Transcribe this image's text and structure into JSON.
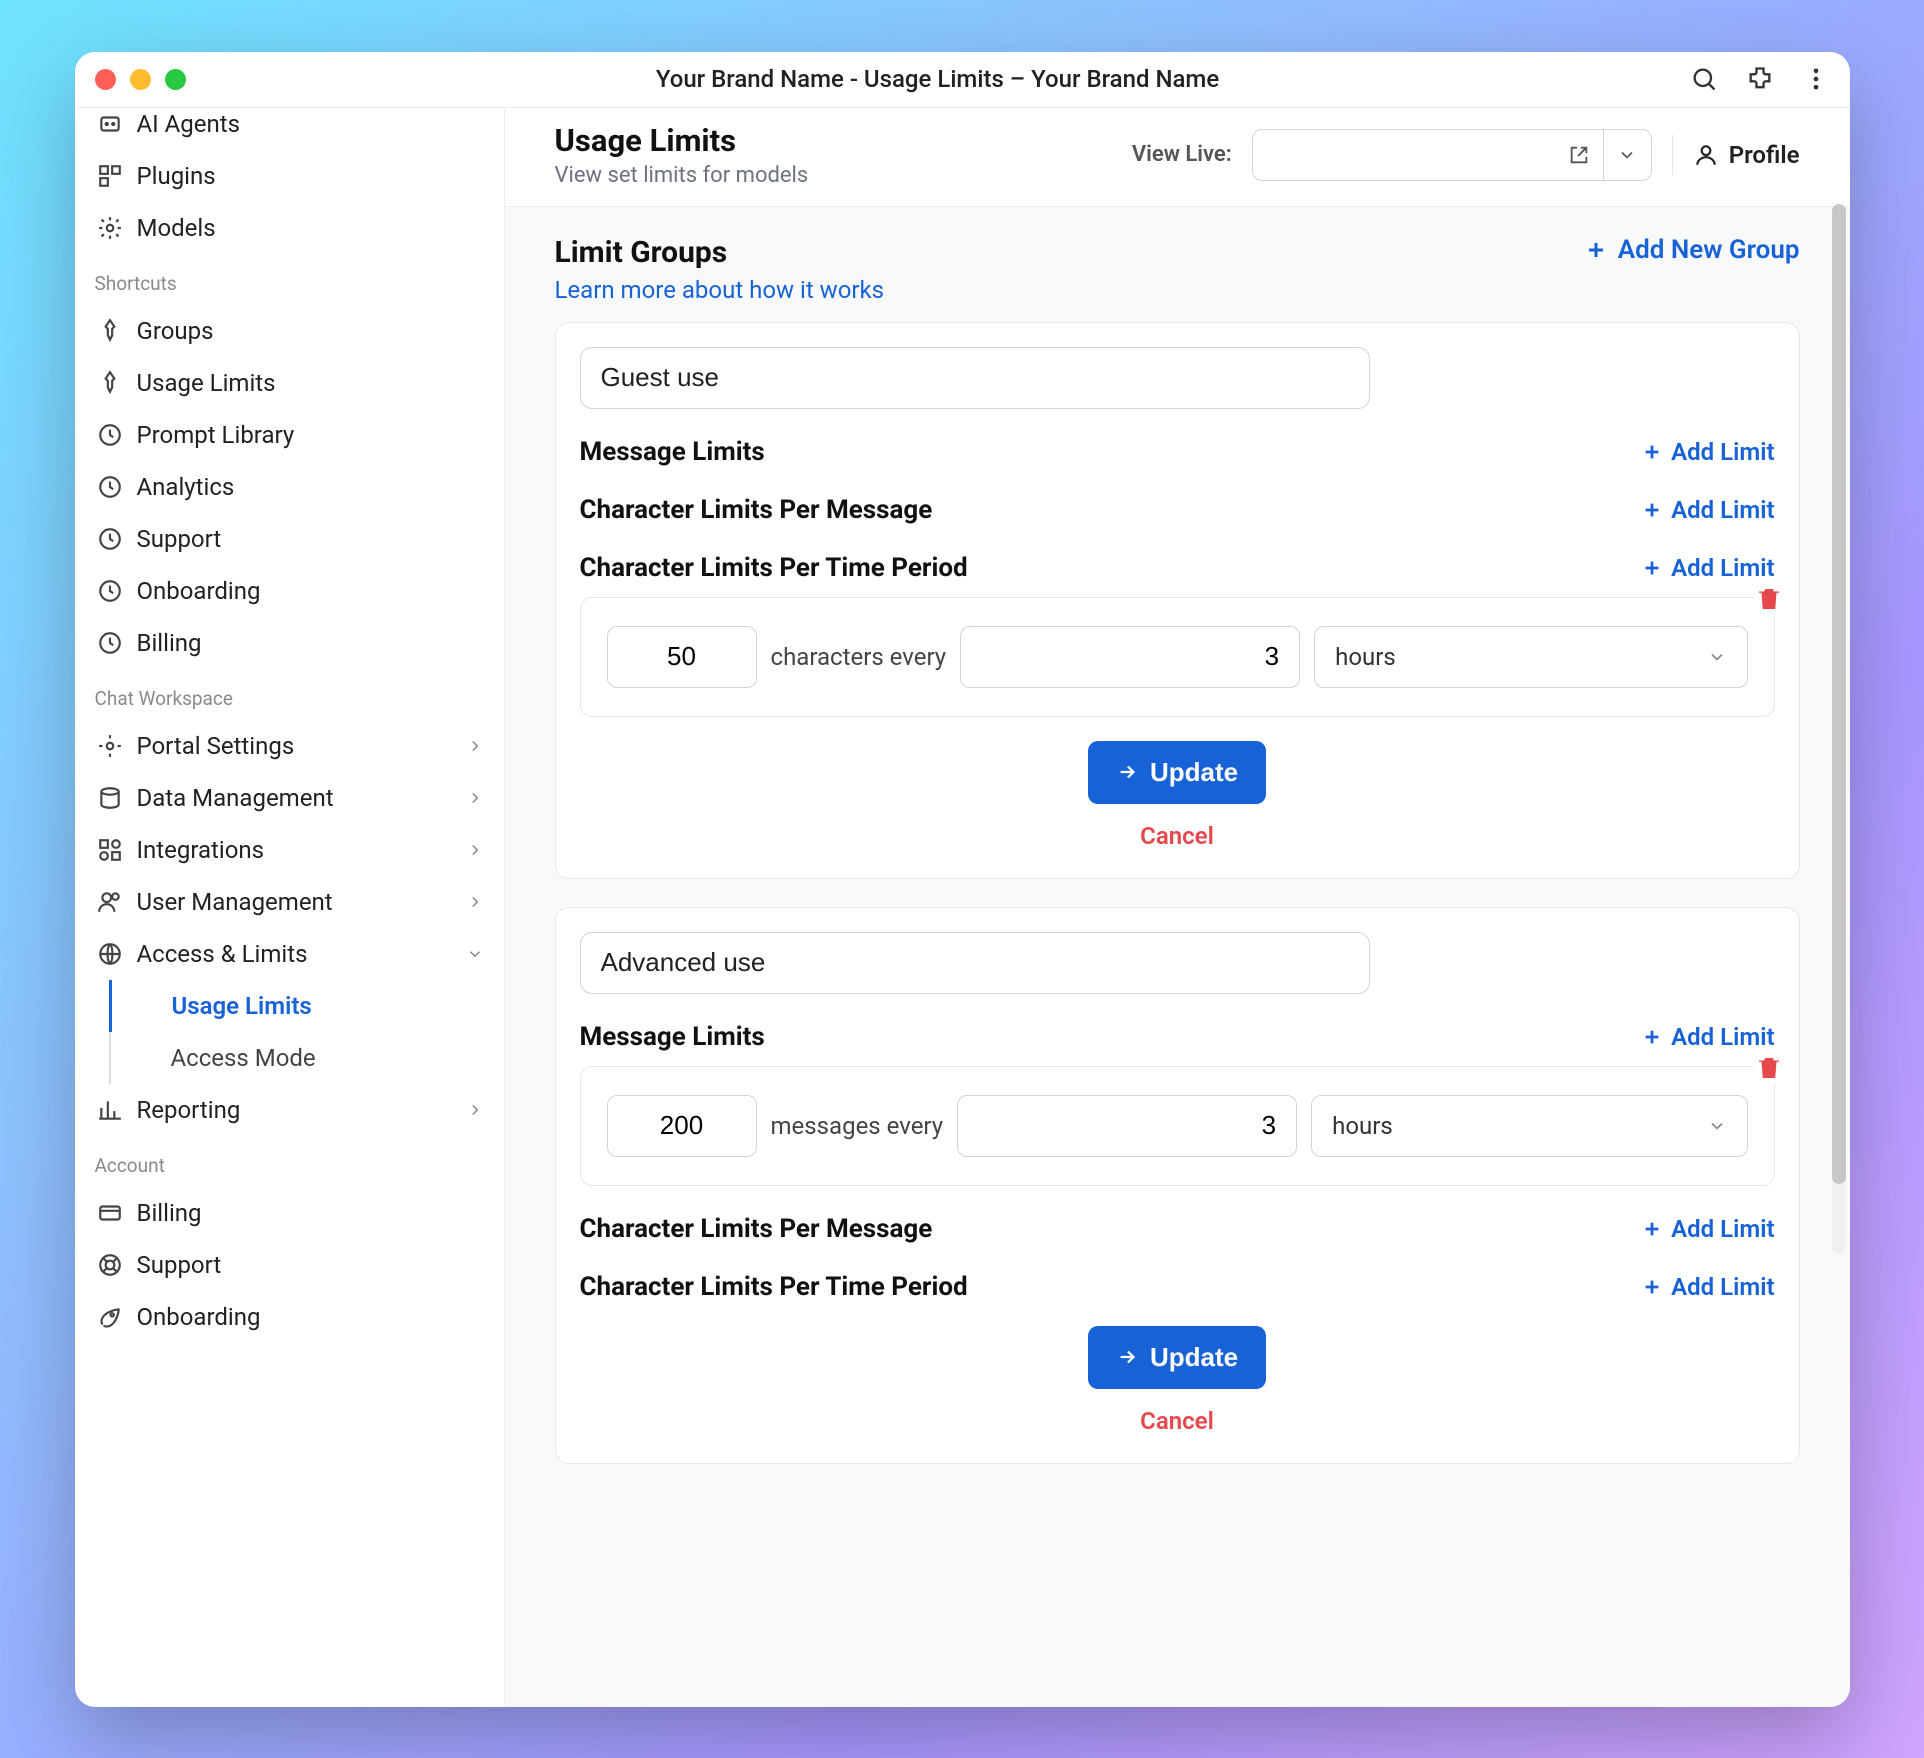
{
  "window_title": "Your Brand Name - Usage Limits – Your Brand Name",
  "sidebar": {
    "top_items": [
      {
        "icon": "ai-agents",
        "label": "AI Agents"
      },
      {
        "icon": "plugins",
        "label": "Plugins"
      },
      {
        "icon": "models",
        "label": "Models"
      }
    ],
    "shortcuts_label": "Shortcuts",
    "shortcuts": [
      {
        "icon": "pin",
        "label": "Groups"
      },
      {
        "icon": "pin",
        "label": "Usage Limits"
      },
      {
        "icon": "clock",
        "label": "Prompt Library"
      },
      {
        "icon": "clock",
        "label": "Analytics"
      },
      {
        "icon": "clock",
        "label": "Support"
      },
      {
        "icon": "clock",
        "label": "Onboarding"
      },
      {
        "icon": "clock",
        "label": "Billing"
      }
    ],
    "workspace_label": "Chat Workspace",
    "workspace": [
      {
        "icon": "gear",
        "label": "Portal Settings",
        "chev": true
      },
      {
        "icon": "db",
        "label": "Data Management",
        "chev": true
      },
      {
        "icon": "grid",
        "label": "Integrations",
        "chev": true
      },
      {
        "icon": "users",
        "label": "User Management",
        "chev": true
      },
      {
        "icon": "globe",
        "label": "Access & Limits",
        "chev": true,
        "open": true,
        "subs": [
          {
            "label": "Usage Limits",
            "active": true
          },
          {
            "label": "Access Mode",
            "active": false
          }
        ]
      },
      {
        "icon": "chart",
        "label": "Reporting",
        "chev": true
      }
    ],
    "account_label": "Account",
    "account": [
      {
        "icon": "card",
        "label": "Billing"
      },
      {
        "icon": "support",
        "label": "Support"
      },
      {
        "icon": "rocket",
        "label": "Onboarding"
      }
    ]
  },
  "header": {
    "title": "Usage Limits",
    "subtitle": "View set limits for models",
    "view_live_label": "View Live:",
    "view_live_value": "",
    "profile_label": "Profile"
  },
  "limit_groups": {
    "title": "Limit Groups",
    "learn_more": "Learn more about how it works",
    "add_group_label": "Add New Group",
    "add_limit_label": "Add Limit",
    "section_message_limits": "Message Limits",
    "section_char_per_message": "Character Limits Per Message",
    "section_char_per_period": "Character Limits Per Time Period",
    "characters_every": "characters every",
    "messages_every": "messages every",
    "unit_hours": "hours",
    "update_label": "Update",
    "cancel_label": "Cancel",
    "groups": [
      {
        "name": "Guest use",
        "char_period": {
          "amount": "50",
          "every": "3",
          "unit": "hours"
        }
      },
      {
        "name": "Advanced use",
        "message_limit": {
          "amount": "200",
          "every": "3",
          "unit": "hours"
        }
      }
    ]
  }
}
